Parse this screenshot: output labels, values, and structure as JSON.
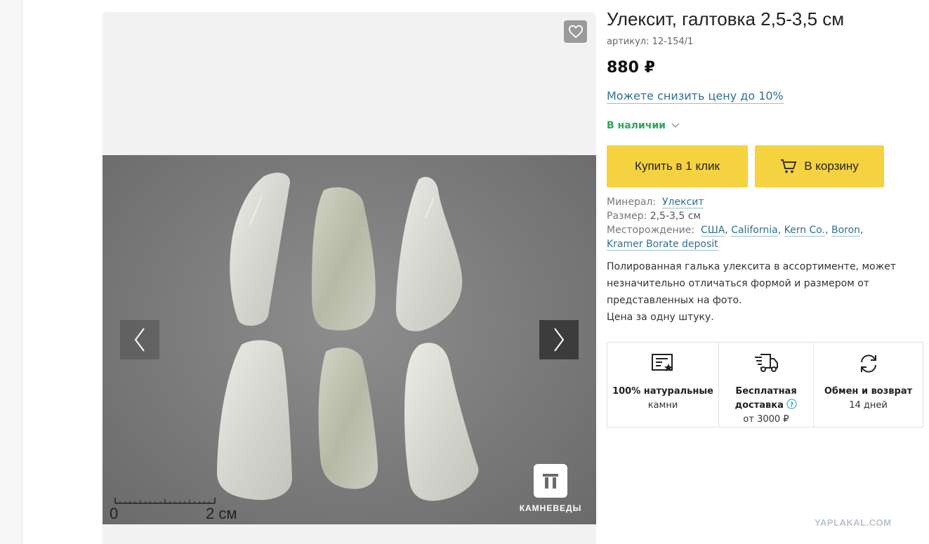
{
  "product": {
    "title": "Улексит, галтовка 2,5-3,5 см",
    "sku": "артикул: 12-154/1",
    "price": "880 ₽",
    "discount_link": "Можете снизить цену до 10%",
    "stock": "В наличии",
    "buy_one_click": "Купить в 1 клик",
    "add_to_cart": "В корзину"
  },
  "properties": {
    "mineral_label": "Минерал:",
    "mineral_value": "Улексит",
    "size_label": "Размер:",
    "size_value": "2,5-3,5 см",
    "deposit_label": "Месторождение:",
    "deposit_links": [
      "США",
      "California",
      "Kern Co.",
      "Boron",
      "Kramer Borate deposit"
    ]
  },
  "description": {
    "line1": "Полированная галька улексита в ассортименте, может",
    "line2": "незначительно отличаться формой и размером от",
    "line3": "представленных на фото.",
    "line4": "Цена за одну штуку."
  },
  "features": [
    {
      "icon": "certificate-icon",
      "bold1": "100% натуральные",
      "bold2": "",
      "normal": "камни"
    },
    {
      "icon": "delivery-truck-icon",
      "bold1": "Бесплатная",
      "bold2": "доставка",
      "normal": "от 3000 ₽"
    },
    {
      "icon": "refresh-icon",
      "bold1": "Обмен и возврат",
      "bold2": "",
      "normal": "14 дней"
    }
  ],
  "gallery": {
    "ruler_zero": "0",
    "ruler_two": "2 см",
    "brand_name": "КАМНЕВЕДЫ"
  },
  "watermark": "YAPLAKAL.COM",
  "colors": {
    "accent_button": "#f5d23f",
    "link": "#2f6f93",
    "in_stock": "#2aa85a"
  }
}
